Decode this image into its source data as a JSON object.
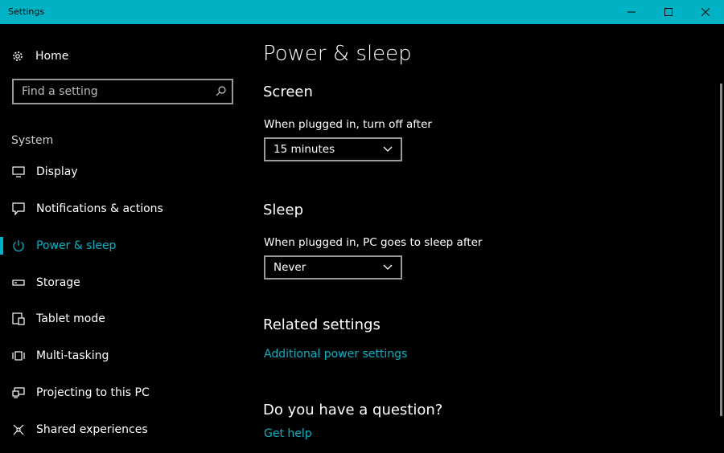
{
  "window": {
    "title": "Settings",
    "controls": {
      "minimize": "minimize-icon",
      "maximize": "maximize-icon",
      "close": "close-icon"
    }
  },
  "sidebar": {
    "home_label": "Home",
    "search_placeholder": "Find a setting",
    "section_label": "System",
    "items": [
      {
        "label": "Display",
        "icon": "display-icon"
      },
      {
        "label": "Notifications & actions",
        "icon": "notifications-icon"
      },
      {
        "label": "Power & sleep",
        "icon": "power-icon",
        "selected": true
      },
      {
        "label": "Storage",
        "icon": "storage-icon"
      },
      {
        "label": "Tablet mode",
        "icon": "tablet-mode-icon"
      },
      {
        "label": "Multi-tasking",
        "icon": "multitasking-icon"
      },
      {
        "label": "Projecting to this PC",
        "icon": "projecting-icon"
      },
      {
        "label": "Shared experiences",
        "icon": "shared-experiences-icon"
      }
    ]
  },
  "main": {
    "title": "Power & sleep",
    "screen": {
      "heading": "Screen",
      "label": "When plugged in, turn off after",
      "value": "15 minutes"
    },
    "sleep": {
      "heading": "Sleep",
      "label": "When plugged in, PC goes to sleep after",
      "value": "Never"
    },
    "related": {
      "heading": "Related settings",
      "link": "Additional power settings"
    },
    "question": {
      "heading": "Do you have a question?",
      "link": "Get help"
    }
  },
  "colors": {
    "accent": "#00b2c3",
    "background": "#000000",
    "text": "#ffffff"
  }
}
